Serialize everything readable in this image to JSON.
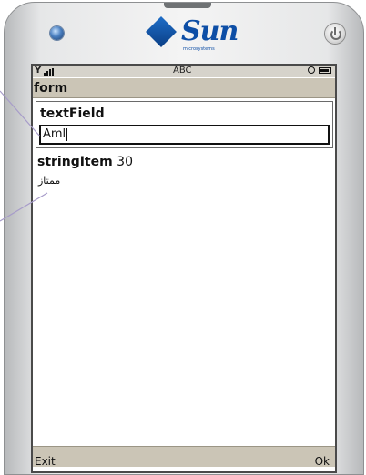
{
  "device": {
    "brand": "Sun",
    "brand_subtitle": "microsystems"
  },
  "status_bar": {
    "mode_text": "ABC",
    "signal_icon": "antenna-icon",
    "clock_icon": "clock-icon",
    "battery_icon": "battery-icon"
  },
  "form": {
    "title": "form",
    "text_field": {
      "label": "textField",
      "value": "Aml"
    },
    "string_item": {
      "label": "stringItem",
      "value": "30",
      "text": "ممتاز"
    }
  },
  "softkeys": {
    "left": "Exit",
    "right": "Ok"
  },
  "colors": {
    "brand_blue": "#0d4ea6",
    "title_bar": "#cbc5b6",
    "annotation_line": "#a79cc9"
  }
}
